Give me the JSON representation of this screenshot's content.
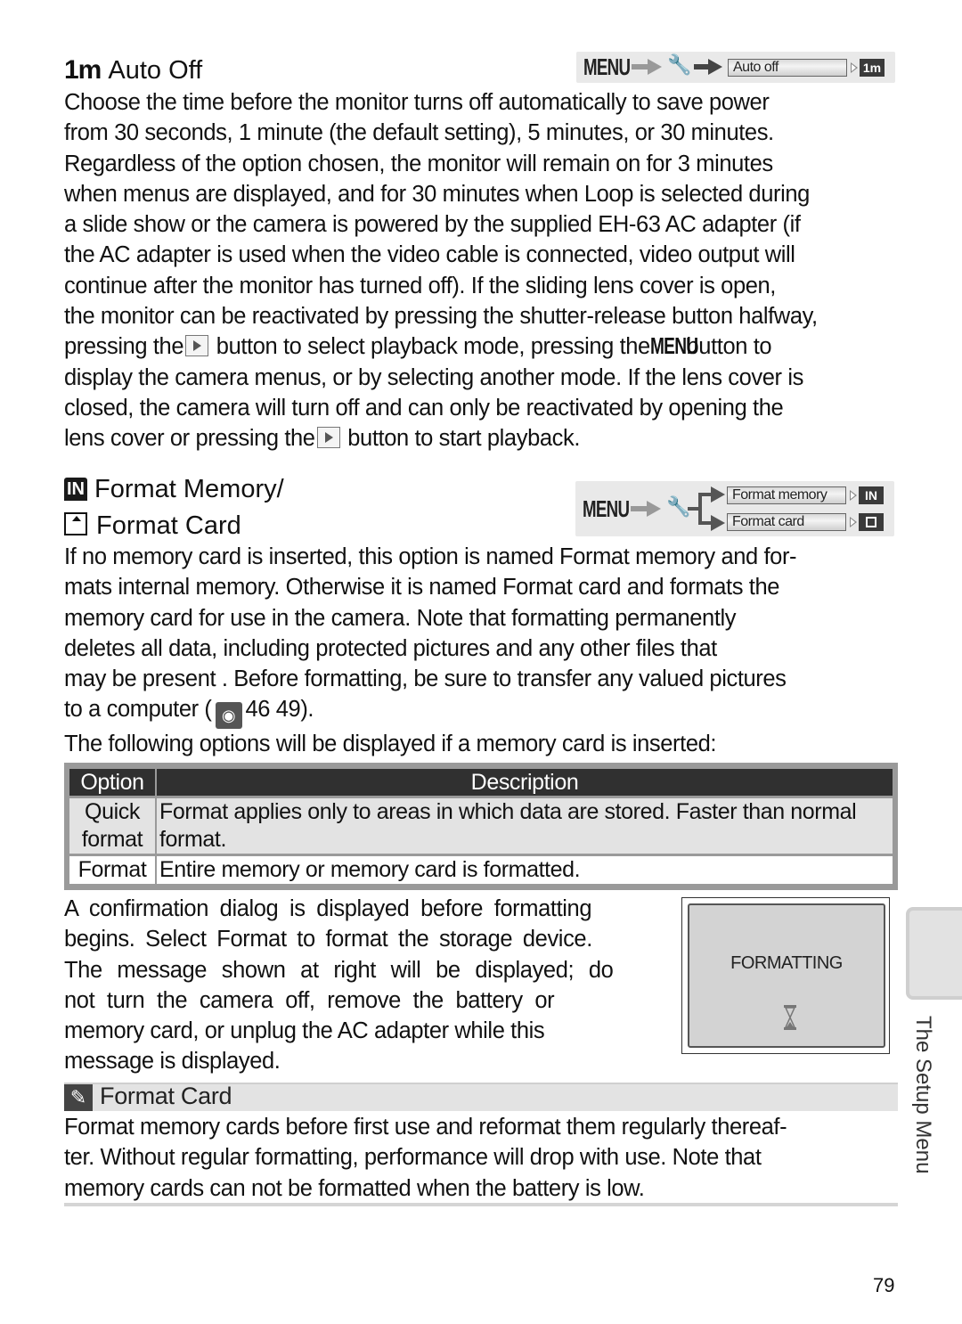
{
  "auto_off": {
    "heading_icon": "1m",
    "heading": "Auto Off",
    "menu_path": {
      "menu_label": "MENU",
      "item_label": "Auto off",
      "badge": "1m"
    },
    "lines": [
      "Choose the time before the monitor turns off automatically to save power",
      "from 30 seconds, 1 minute (the default setting), 5 minutes, or 30 minutes.",
      "Regardless of the option chosen, the monitor will remain on for 3 minutes",
      "when menus are displayed, and for 30 minutes when Loop is selected during",
      "a slide show or the camera is powered by the supplied EH-63 AC adapter (if",
      "the AC adapter is used when the video cable is connected, video output will",
      "continue after the monitor has turned off).  If the sliding lens cover is open,",
      "the monitor can be reactivated by pressing the shutter-release button halfway,"
    ],
    "line9_a": "pressing the",
    "line9_b": " button to select playback mode, pressing the",
    "line9_menu": "MENU",
    "line9_c": " button to",
    "line10": "display the camera menus, or by selecting another mode.  If the lens cover is",
    "line11": "closed, the camera will turn off and can only be reactivated by opening the",
    "line12_a": "lens cover or pressing the",
    "line12_b": " button to start playback."
  },
  "format": {
    "heading_icon_in": "IN",
    "heading_line1": "Format Memory/",
    "heading_line2": "Format Card",
    "menu_path": {
      "menu_label": "MENU",
      "item1_label": "Format memory",
      "item1_badge": "IN",
      "item2_label": "Format card",
      "item2_badge": "card"
    },
    "lines": [
      "If no memory card is inserted, this option is named Format memory  and for-",
      "mats internal memory.  Otherwise it is named Format card  and formats the",
      "memory card for use in the camera. Note that formatting permanently",
      "deletes all data, including protected pictures and any other files that",
      "may be present .  Before formatting, be sure to transfer any valued pictures"
    ],
    "ref_a": "to a computer (",
    "ref_pages": "46 49",
    "ref_b": ").",
    "table_intro": "The following options will be displayed if a memory card is inserted:",
    "table": {
      "headers": [
        "Option",
        "Description"
      ],
      "rows": [
        {
          "option": "Quick format",
          "description": "Format applies only to areas in which data are stored.  Faster than normal format."
        },
        {
          "option": "Format",
          "description": "Entire memory or memory card is formatted."
        }
      ]
    },
    "dialog_lines": [
      "A confirmation dialog is displayed before formatting",
      "begins.  Select Format  to format the storage device.",
      "The message shown at right will be displayed; do",
      "not turn the camera off, remove the battery or",
      "memory card, or unplug the AC adapter while this",
      "message is displayed."
    ],
    "screen_message": "FORMATTING"
  },
  "tip": {
    "title": "Format Card",
    "lines": [
      "Format memory cards before first use and reformat them regularly thereaf-",
      "ter.  Without regular formatting, performance will drop with use.  Note that",
      "memory cards can not be formatted when the battery is low."
    ]
  },
  "side_tab": "The Setup Menu",
  "page_number": "79"
}
